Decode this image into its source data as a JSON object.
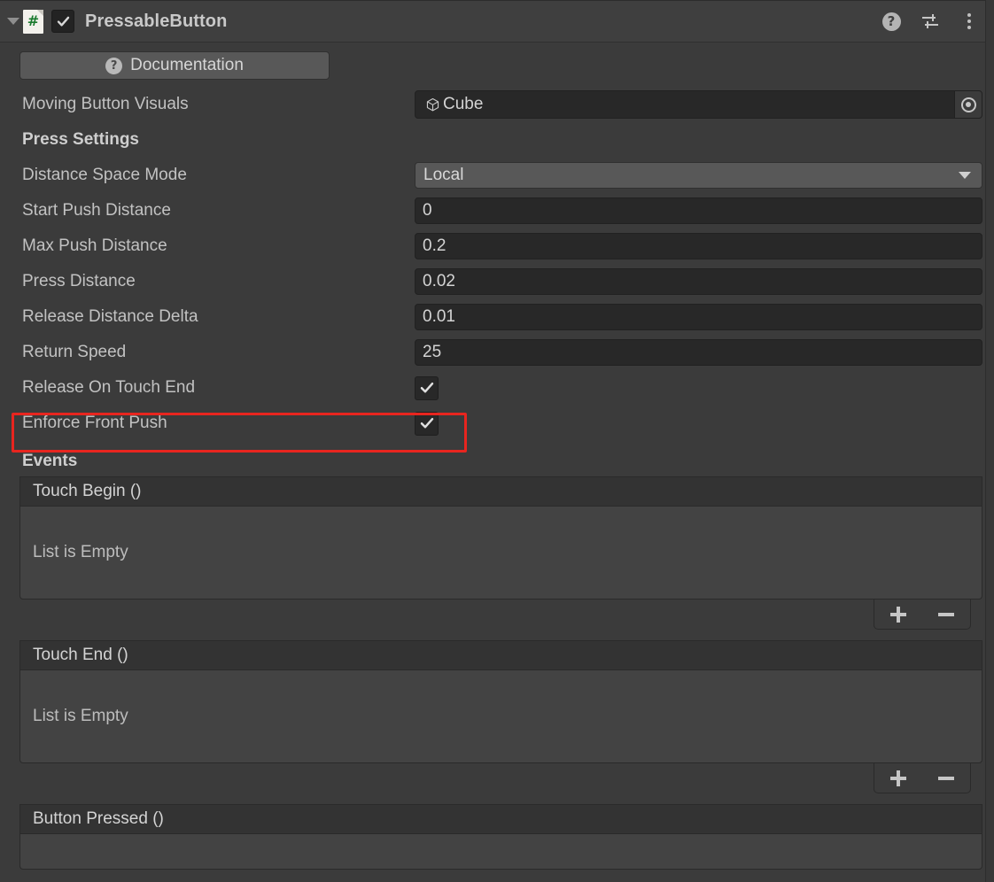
{
  "header": {
    "foldout_icon": "triangle-down-icon",
    "script_icon": "csharp-script-icon",
    "script_icon_glyph": "#",
    "enabled": true,
    "title": "PressableButton",
    "icons": [
      {
        "name": "help-icon",
        "glyph": "?"
      },
      {
        "name": "preset-icon",
        "glyph": "sliders"
      },
      {
        "name": "more-menu-icon",
        "glyph": "kebab"
      }
    ]
  },
  "documentation": {
    "icon": "help-icon",
    "icon_glyph": "?",
    "label": "Documentation"
  },
  "properties": {
    "moving_button_visuals": {
      "label": "Moving Button Visuals",
      "icon": "cube-icon",
      "value": "Cube",
      "picker_icon": "target-picker-icon"
    },
    "press_settings_header": "Press Settings",
    "distance_space_mode": {
      "label": "Distance Space Mode",
      "value": "Local",
      "arrow_icon": "chevron-down-icon"
    },
    "start_push_distance": {
      "label": "Start Push Distance",
      "value": "0"
    },
    "max_push_distance": {
      "label": "Max Push Distance",
      "value": "0.2"
    },
    "press_distance": {
      "label": "Press Distance",
      "value": "0.02"
    },
    "release_distance_delta": {
      "label": "Release Distance Delta",
      "value": "0.01"
    },
    "return_speed": {
      "label": "Return Speed",
      "value": "25"
    },
    "release_on_touch_end": {
      "label": "Release On Touch End",
      "checked": true
    },
    "enforce_front_push": {
      "label": "Enforce Front Push",
      "checked": true,
      "highlighted": true
    }
  },
  "events": {
    "heading": "Events",
    "empty_text": "List is Empty",
    "add_icon": "plus-icon",
    "remove_icon": "minus-icon",
    "list": [
      {
        "label": "Touch Begin ()",
        "empty": "List is Empty",
        "has_footer": true
      },
      {
        "label": "Touch End ()",
        "empty": "List is Empty",
        "has_footer": true
      },
      {
        "label": "Button Pressed ()",
        "empty": "",
        "has_footer": false
      }
    ]
  },
  "colors": {
    "background": "#3b3b3b",
    "header_bg": "#3f3f3f",
    "field_bg": "#282828",
    "control_bg": "#585858",
    "event_body_bg": "#434343",
    "highlight_red": "#e8251f",
    "script_green": "#1a7a2e",
    "text": "#c2c2c2"
  }
}
